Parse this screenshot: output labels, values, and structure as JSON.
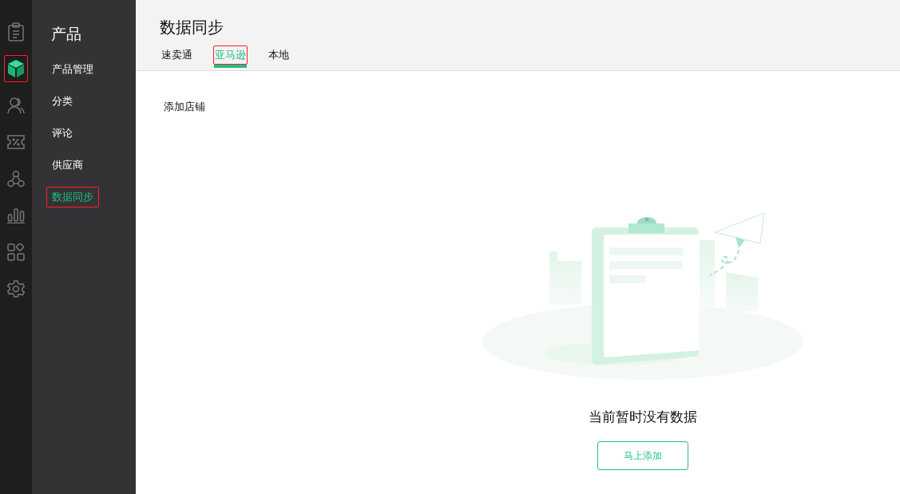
{
  "rail": [
    {
      "kind": "clipboard",
      "selected": false
    },
    {
      "kind": "cube",
      "selected": true
    },
    {
      "kind": "users",
      "selected": false
    },
    {
      "kind": "coupon",
      "selected": false
    },
    {
      "kind": "nodes",
      "selected": false
    },
    {
      "kind": "bars",
      "selected": false
    },
    {
      "kind": "apps",
      "selected": false
    },
    {
      "kind": "gear",
      "selected": false
    }
  ],
  "sidebar": {
    "title": "产品",
    "items": [
      {
        "label": "产品管理",
        "selected": false
      },
      {
        "label": "分类",
        "selected": false
      },
      {
        "label": "评论",
        "selected": false
      },
      {
        "label": "供应商",
        "selected": false
      },
      {
        "label": "数据同步",
        "selected": true
      }
    ]
  },
  "page": {
    "title": "数据同步"
  },
  "tabs": [
    {
      "label": "速卖通",
      "selected": false
    },
    {
      "label": "亚马逊",
      "selected": true
    },
    {
      "label": "本地",
      "selected": false
    }
  ],
  "add_store_link": "添加店铺",
  "empty_state": {
    "message": "当前暂时没有数据",
    "button": "马上添加"
  }
}
